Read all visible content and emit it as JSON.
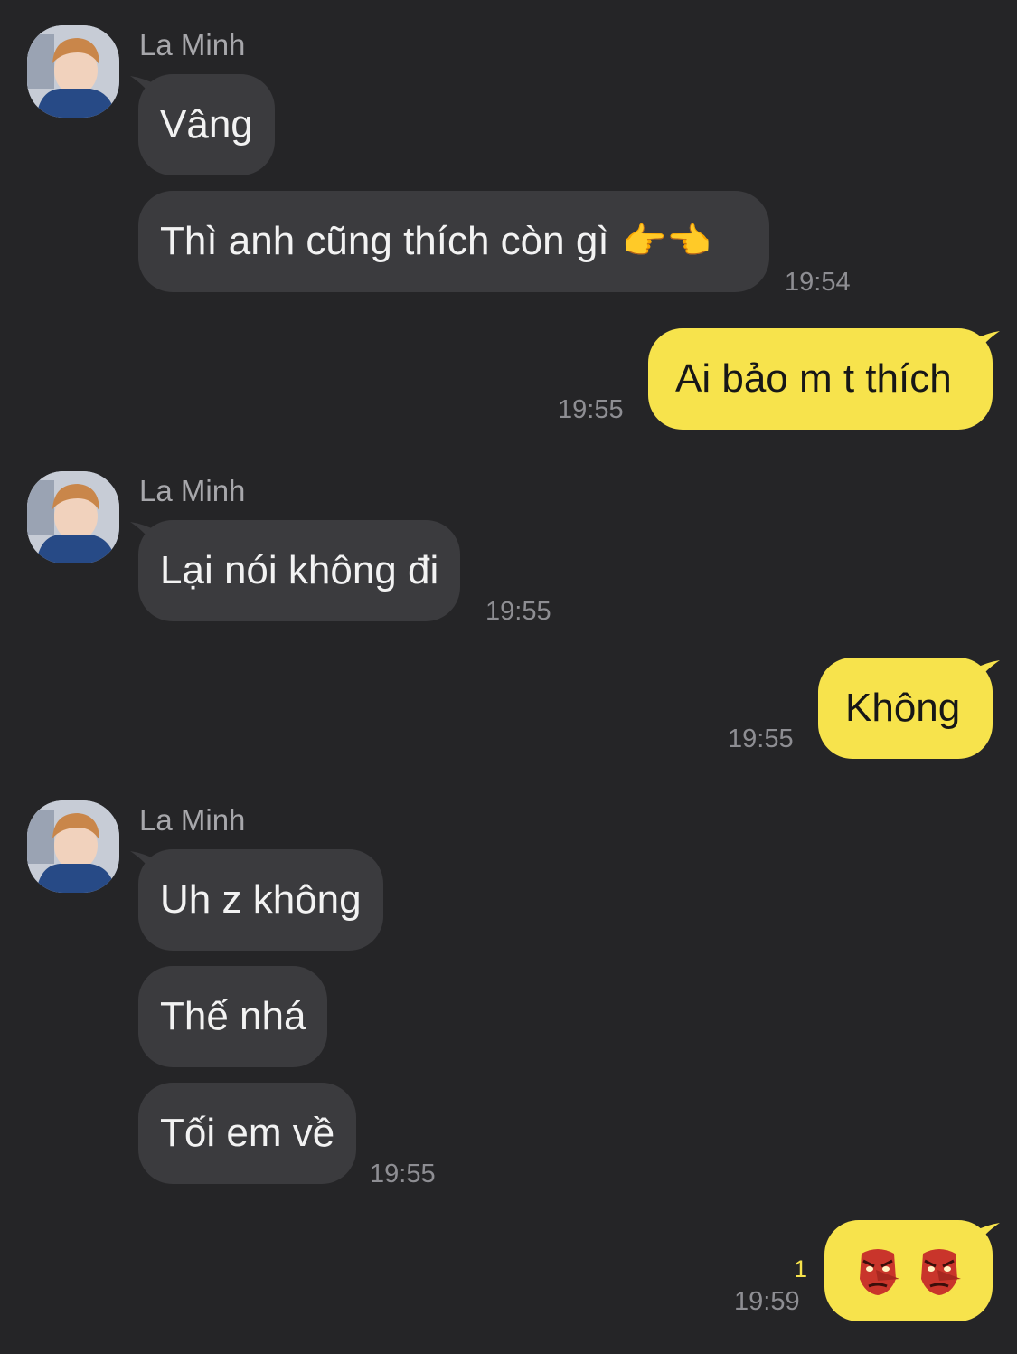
{
  "chat": {
    "sender_name": "La Minh",
    "messages": [
      {
        "side": "in",
        "text": "Vâng"
      },
      {
        "side": "in",
        "text": "Thì anh cũng thích còn gì",
        "emoji": "👉👈",
        "time": "19:54"
      },
      {
        "side": "out",
        "text": "Ai bảo m t thích",
        "time": "19:55"
      },
      {
        "side": "in",
        "text": "Lại nói không đi",
        "time": "19:55"
      },
      {
        "side": "out",
        "text": "Không",
        "time": "19:55"
      },
      {
        "side": "in",
        "text": "Uh z không"
      },
      {
        "side": "in",
        "text": "Thế nhá"
      },
      {
        "side": "in",
        "text": "Tối em về",
        "time": "19:55"
      },
      {
        "side": "out",
        "icons": [
          "tengu-mask-icon",
          "tengu-mask-icon"
        ],
        "time": "19:59",
        "unread_count": "1"
      }
    ]
  },
  "colors": {
    "background": "#252527",
    "incoming_bubble": "#3b3b3e",
    "outgoing_bubble": "#f7e34c",
    "timestamp": "#8e8e93",
    "unread": "#f7e34c"
  }
}
